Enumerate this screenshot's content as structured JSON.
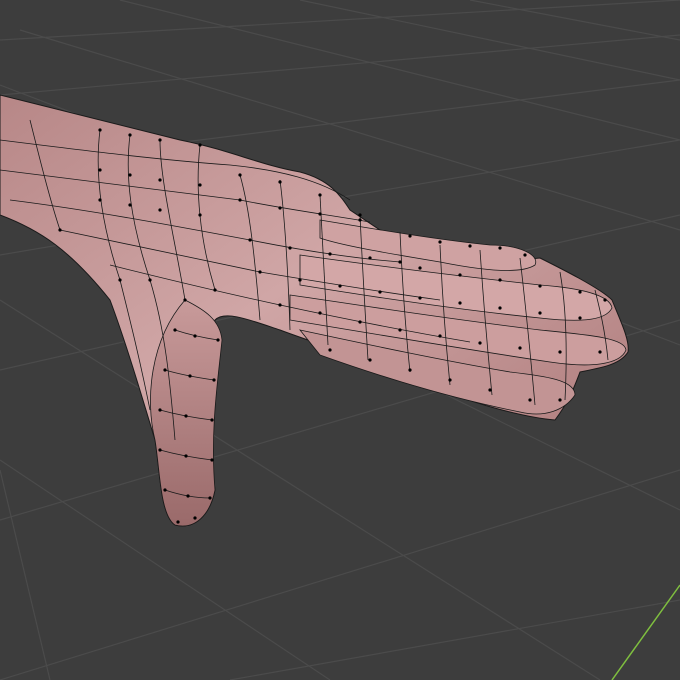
{
  "viewport": {
    "mode": "edit-mesh",
    "object": "hand-mesh",
    "background_color": "#3d3d3d",
    "grid_color": "#4a4a4a",
    "axis_y_color": "#7fbf3f",
    "mesh_color": "#c9a0a0",
    "wire_color": "#1a1a1a",
    "vertex_color": "#000000"
  }
}
